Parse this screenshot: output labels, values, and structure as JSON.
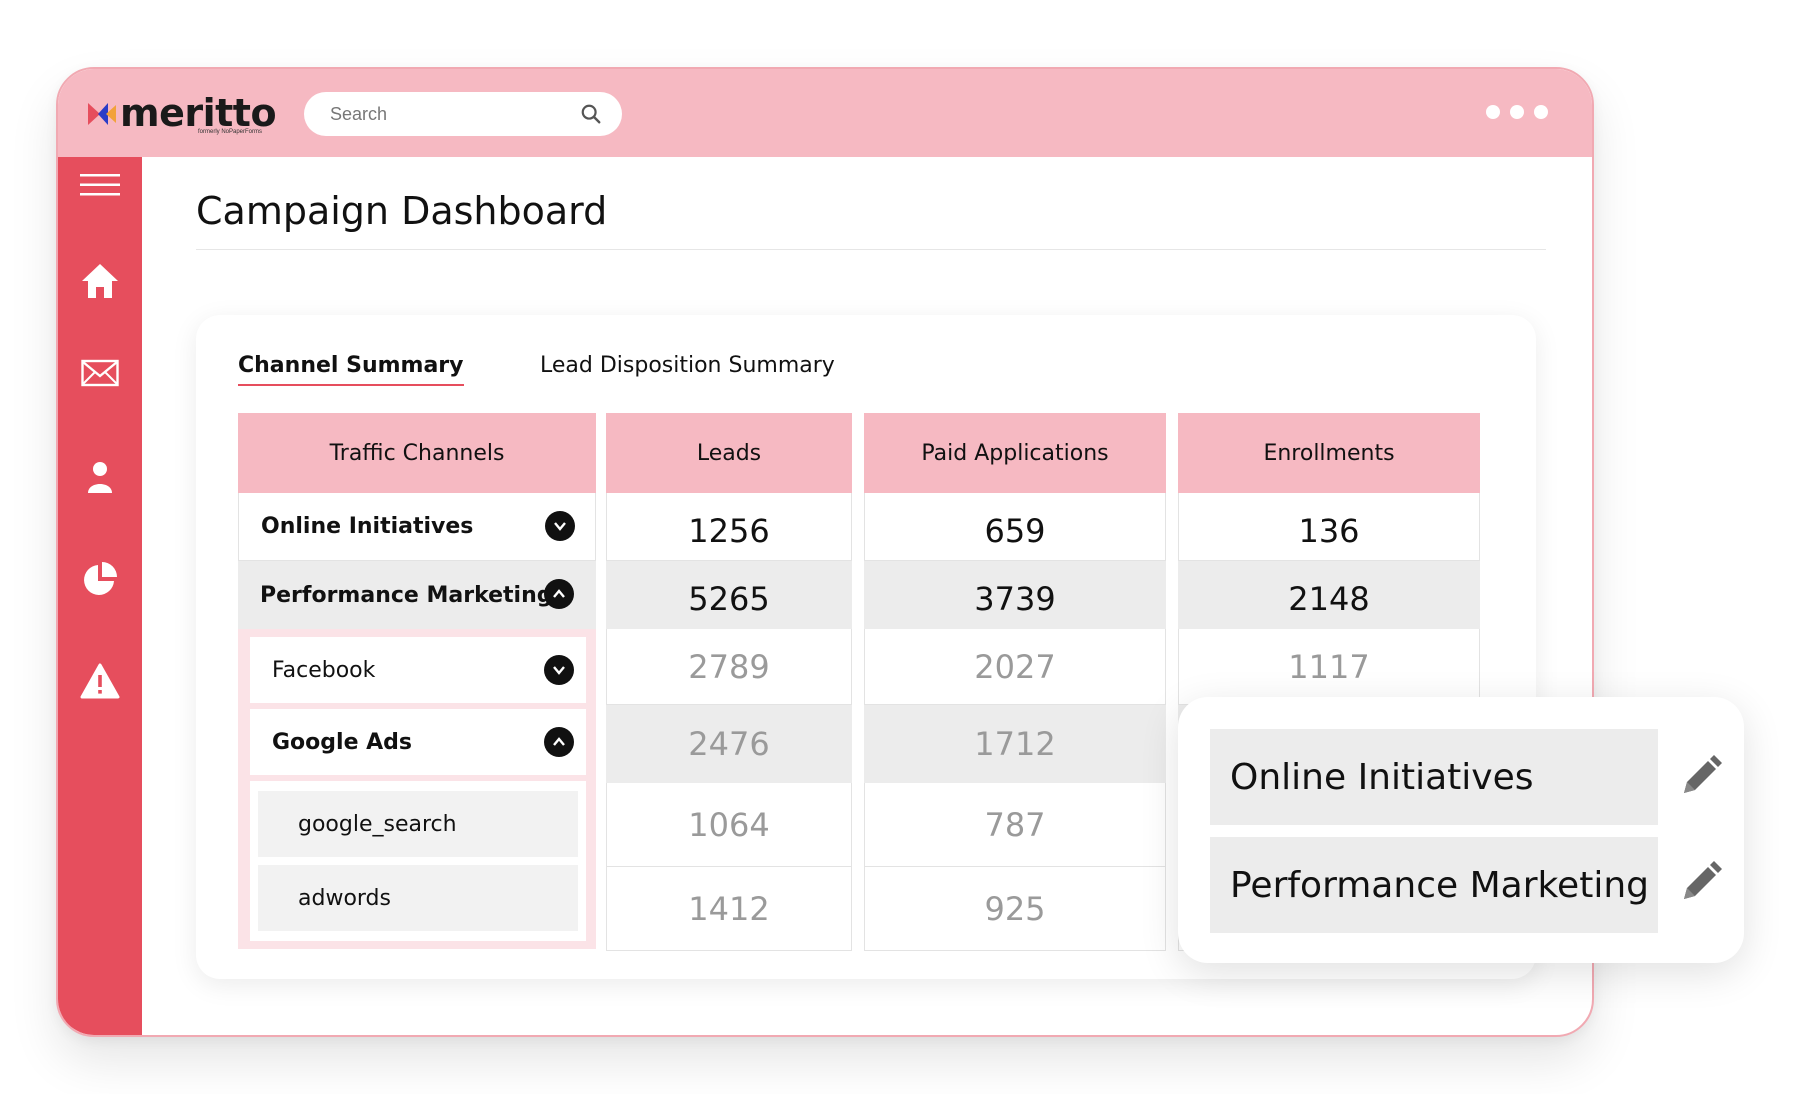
{
  "brand": {
    "name": "meritto",
    "tagline": "formerly NoPaperForms"
  },
  "search": {
    "placeholder": "Search"
  },
  "page": {
    "title": "Campaign Dashboard"
  },
  "tabs": [
    {
      "label": "Channel Summary",
      "active": true
    },
    {
      "label": "Lead Disposition Summary",
      "active": false
    }
  ],
  "table": {
    "headers": [
      "Traffic Channels",
      "Leads",
      "Paid Applications",
      "Enrollments"
    ],
    "rows": [
      {
        "channel": "Online Initiatives",
        "leads": "1256",
        "paid": "659",
        "enrollments": "136",
        "expanded": false
      },
      {
        "channel": "Performance Marketing",
        "leads": "5265",
        "paid": "3739",
        "enrollments": "2148",
        "expanded": true
      },
      {
        "channel": "Facebook",
        "leads": "2789",
        "paid": "2027",
        "enrollments": "1117",
        "expanded": false
      },
      {
        "channel": "Google Ads",
        "leads": "2476",
        "paid": "1712",
        "enrollments": "",
        "expanded": true
      },
      {
        "channel": "google_search",
        "leads": "1064",
        "paid": "787",
        "enrollments": ""
      },
      {
        "channel": "adwords",
        "leads": "1412",
        "paid": "925",
        "enrollments": ""
      }
    ]
  },
  "popup": {
    "items": [
      "Online Initiatives",
      "Performance Marketing"
    ]
  },
  "colors": {
    "accent": "#e64e5d",
    "header_pink": "#f6b9c2",
    "topbar": "#f6b9c2"
  },
  "icons": {
    "sidebar": [
      "hamburger-icon",
      "home-icon",
      "mail-icon",
      "user-icon",
      "pie-chart-icon",
      "alert-icon"
    ]
  }
}
